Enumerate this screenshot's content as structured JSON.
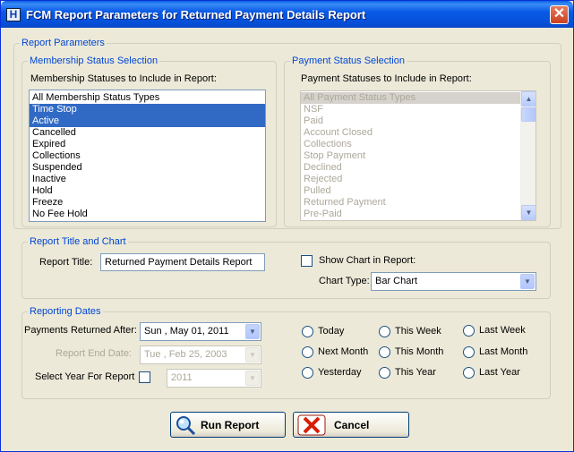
{
  "window": {
    "title": "FCM Report Parameters for Returned Payment Details Report",
    "icon_letter": "H",
    "close_glyph": "✕"
  },
  "report_parameters": {
    "legend": "Report Parameters",
    "membership": {
      "legend": "Membership Status Selection",
      "label": "Membership Statuses to Include in Report:",
      "items": [
        {
          "label": "All Membership Status Types",
          "selected": false
        },
        {
          "label": "Time Stop",
          "selected": true
        },
        {
          "label": "Active",
          "selected": true
        },
        {
          "label": "Cancelled",
          "selected": false
        },
        {
          "label": "Expired",
          "selected": false
        },
        {
          "label": "Collections",
          "selected": false
        },
        {
          "label": "Suspended",
          "selected": false
        },
        {
          "label": "Inactive",
          "selected": false
        },
        {
          "label": "Hold",
          "selected": false
        },
        {
          "label": "Freeze",
          "selected": false
        },
        {
          "label": "No Fee Hold",
          "selected": false
        }
      ]
    },
    "payment": {
      "legend": "Payment Status Selection",
      "label": "Payment Statuses to Include in Report:",
      "enabled": false,
      "items": [
        {
          "label": "All Payment Status Types",
          "selected": true
        },
        {
          "label": "NSF",
          "selected": false
        },
        {
          "label": "Paid",
          "selected": false
        },
        {
          "label": "Account Closed",
          "selected": false
        },
        {
          "label": "Collections",
          "selected": false
        },
        {
          "label": "Stop Payment",
          "selected": false
        },
        {
          "label": "Declined",
          "selected": false
        },
        {
          "label": "Rejected",
          "selected": false
        },
        {
          "label": "Pulled",
          "selected": false
        },
        {
          "label": "Returned Payment",
          "selected": false
        },
        {
          "label": "Pre-Paid",
          "selected": false
        }
      ]
    }
  },
  "title_chart": {
    "legend": "Report Title and Chart",
    "report_title_label": "Report Title:",
    "report_title_value": "Returned Payment Details Report",
    "show_chart_label": "Show Chart in Report:",
    "show_chart_checked": false,
    "chart_type_label": "Chart Type:",
    "chart_type_value": "Bar Chart"
  },
  "reporting_dates": {
    "legend": "Reporting Dates",
    "returned_after_label": "Payments Returned After:",
    "returned_after_value": "Sun , May 01, 2011",
    "end_date_label": "Report End Date:",
    "end_date_value": "Tue , Feb 25, 2003",
    "select_year_label": "Select Year For Report",
    "select_year_checked": false,
    "year_value": "2011",
    "radios": [
      {
        "label": "Today",
        "checked": false
      },
      {
        "label": "This Week",
        "checked": false
      },
      {
        "label": "Last Week",
        "checked": false
      },
      {
        "label": "Next Month",
        "checked": false
      },
      {
        "label": "This Month",
        "checked": false
      },
      {
        "label": "Last Month",
        "checked": false
      },
      {
        "label": "Yesterday",
        "checked": false
      },
      {
        "label": "This Year",
        "checked": false
      },
      {
        "label": "Last Year",
        "checked": false
      }
    ]
  },
  "buttons": {
    "run_label": "Run Report",
    "cancel_label": "Cancel",
    "run_icon": "magnifier-icon",
    "cancel_icon": "red-x-icon"
  },
  "colors": {
    "titlebar": "#0a5ae6",
    "selection": "#316ac5",
    "legend_text": "#0046d5",
    "cancel_icon": "#d81e06"
  }
}
